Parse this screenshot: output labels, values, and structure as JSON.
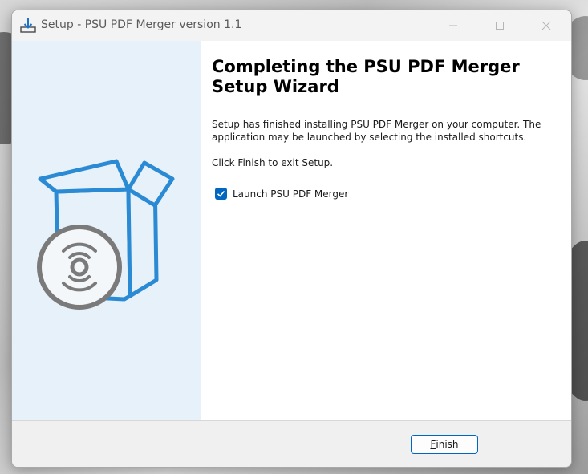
{
  "window": {
    "title": "Setup - PSU PDF Merger version 1.1"
  },
  "content": {
    "heading": "Completing the PSU PDF Merger Setup Wizard",
    "paragraph1": "Setup has finished installing PSU PDF Merger on your computer. The application may be launched by selecting the installed shortcuts.",
    "paragraph2": "Click Finish to exit Setup.",
    "launch_checkbox": {
      "label": "Launch PSU PDF Merger",
      "checked": true
    }
  },
  "footer": {
    "finish_label_first": "F",
    "finish_label_rest": "inish"
  },
  "icons": {
    "app": "setup-download-icon",
    "sidebar": "box-with-disc-icon"
  },
  "colors": {
    "accent": "#0067c0",
    "sidebar_bg": "#e7f1f9",
    "illustration_blue": "#2a8ad4",
    "illustration_gray": "#7a7a7a"
  }
}
